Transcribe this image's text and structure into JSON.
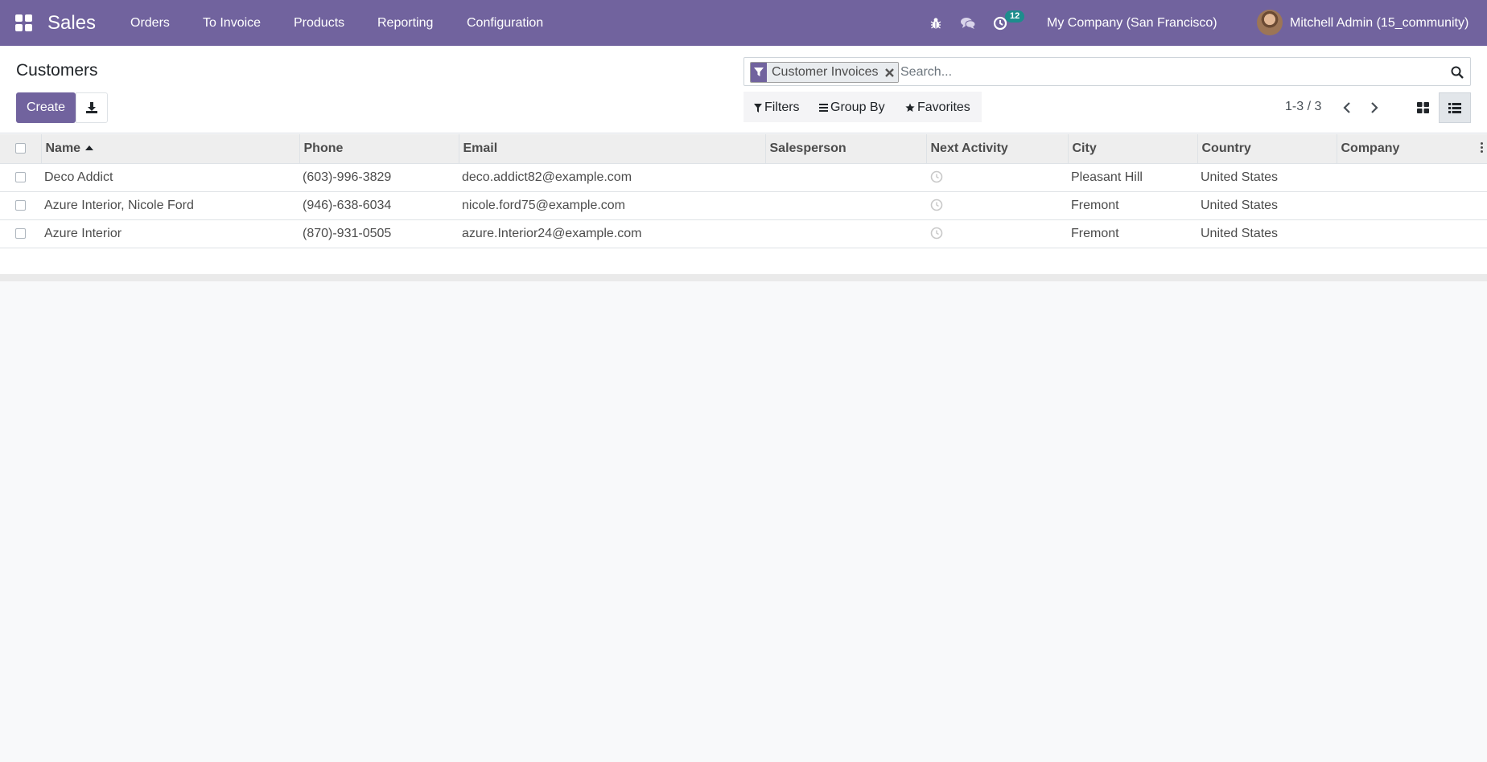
{
  "navbar": {
    "app_name": "Sales",
    "menu": [
      "Orders",
      "To Invoice",
      "Products",
      "Reporting",
      "Configuration"
    ],
    "activity_count": "12",
    "company": "My Company (San Francisco)",
    "user": "Mitchell Admin (15_community)"
  },
  "control_panel": {
    "title": "Customers",
    "create_label": "Create",
    "search": {
      "facet_label": "Customer Invoices",
      "placeholder": "Search..."
    },
    "filters_label": "Filters",
    "group_by_label": "Group By",
    "favorites_label": "Favorites",
    "pager": "1-3 / 3"
  },
  "table": {
    "columns": [
      "Name",
      "Phone",
      "Email",
      "Salesperson",
      "Next Activity",
      "City",
      "Country",
      "Company"
    ],
    "rows": [
      {
        "name": "Deco Addict",
        "phone": "(603)-996-3829",
        "email": "deco.addict82@example.com",
        "salesperson": "",
        "city": "Pleasant Hill",
        "country": "United States",
        "company": ""
      },
      {
        "name": "Azure Interior, Nicole Ford",
        "phone": "(946)-638-6034",
        "email": "nicole.ford75@example.com",
        "salesperson": "",
        "city": "Fremont",
        "country": "United States",
        "company": ""
      },
      {
        "name": "Azure Interior",
        "phone": "(870)-931-0505",
        "email": "azure.Interior24@example.com",
        "salesperson": "",
        "city": "Fremont",
        "country": "United States",
        "company": ""
      }
    ]
  },
  "colors": {
    "brand": "#71639e",
    "badge": "#1d8d8d"
  },
  "icons": {
    "apps": "apps-grid-icon",
    "debug": "bug-icon",
    "messages": "chat-icon",
    "activities": "clock-icon",
    "download": "download-icon",
    "search": "search-icon",
    "filter": "filter-icon",
    "group_by": "bars-icon",
    "favorites": "star-icon",
    "kanban_view": "kanban-icon",
    "list_view": "list-icon"
  }
}
